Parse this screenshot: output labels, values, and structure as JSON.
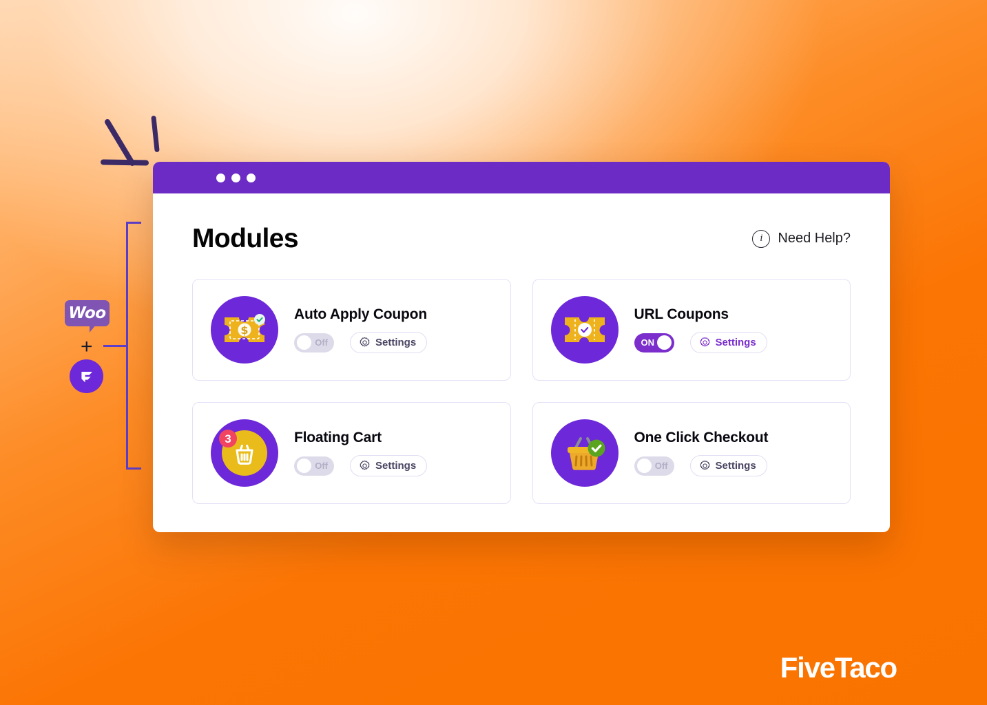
{
  "brand": {
    "wordmark": "FiveTaco",
    "woo_logo_text": "Woo",
    "plus_symbol": "+",
    "fivetaco_mark_icon": "fivetaco-f-icon",
    "accent_purple": "#6d28d9",
    "titlebar_purple": "#6b2bc4",
    "toggle_on_purple": "#7b2ecc",
    "background_orange": "#f97300",
    "bracket_purple": "#5b3ec9",
    "sparkle_navy": "#3b2a66"
  },
  "window": {
    "titlebar_dots": 3
  },
  "header": {
    "title": "Modules",
    "help": {
      "icon": "info-circle-icon",
      "icon_glyph": "i",
      "label": "Need Help?"
    }
  },
  "modules": [
    {
      "id": "auto-apply-coupon",
      "title": "Auto Apply Coupon",
      "icon": "coupon-dollar-ticket-icon",
      "toggle": {
        "state": "off",
        "label": "Off"
      },
      "settings": {
        "label": "Settings",
        "icon": "gear-icon",
        "accent": false
      }
    },
    {
      "id": "url-coupons",
      "title": "URL Coupons",
      "icon": "coupon-check-ticket-icon",
      "toggle": {
        "state": "on",
        "label": "ON"
      },
      "settings": {
        "label": "Settings",
        "icon": "gear-icon",
        "accent": true
      }
    },
    {
      "id": "floating-cart",
      "title": "Floating Cart",
      "icon": "floating-cart-basket-icon",
      "badge_count": "3",
      "toggle": {
        "state": "off",
        "label": "Off"
      },
      "settings": {
        "label": "Settings",
        "icon": "gear-icon",
        "accent": false
      }
    },
    {
      "id": "one-click-checkout",
      "title": "One Click Checkout",
      "icon": "checkout-basket-check-icon",
      "toggle": {
        "state": "off",
        "label": "Off"
      },
      "settings": {
        "label": "Settings",
        "icon": "gear-icon",
        "accent": false
      }
    }
  ]
}
